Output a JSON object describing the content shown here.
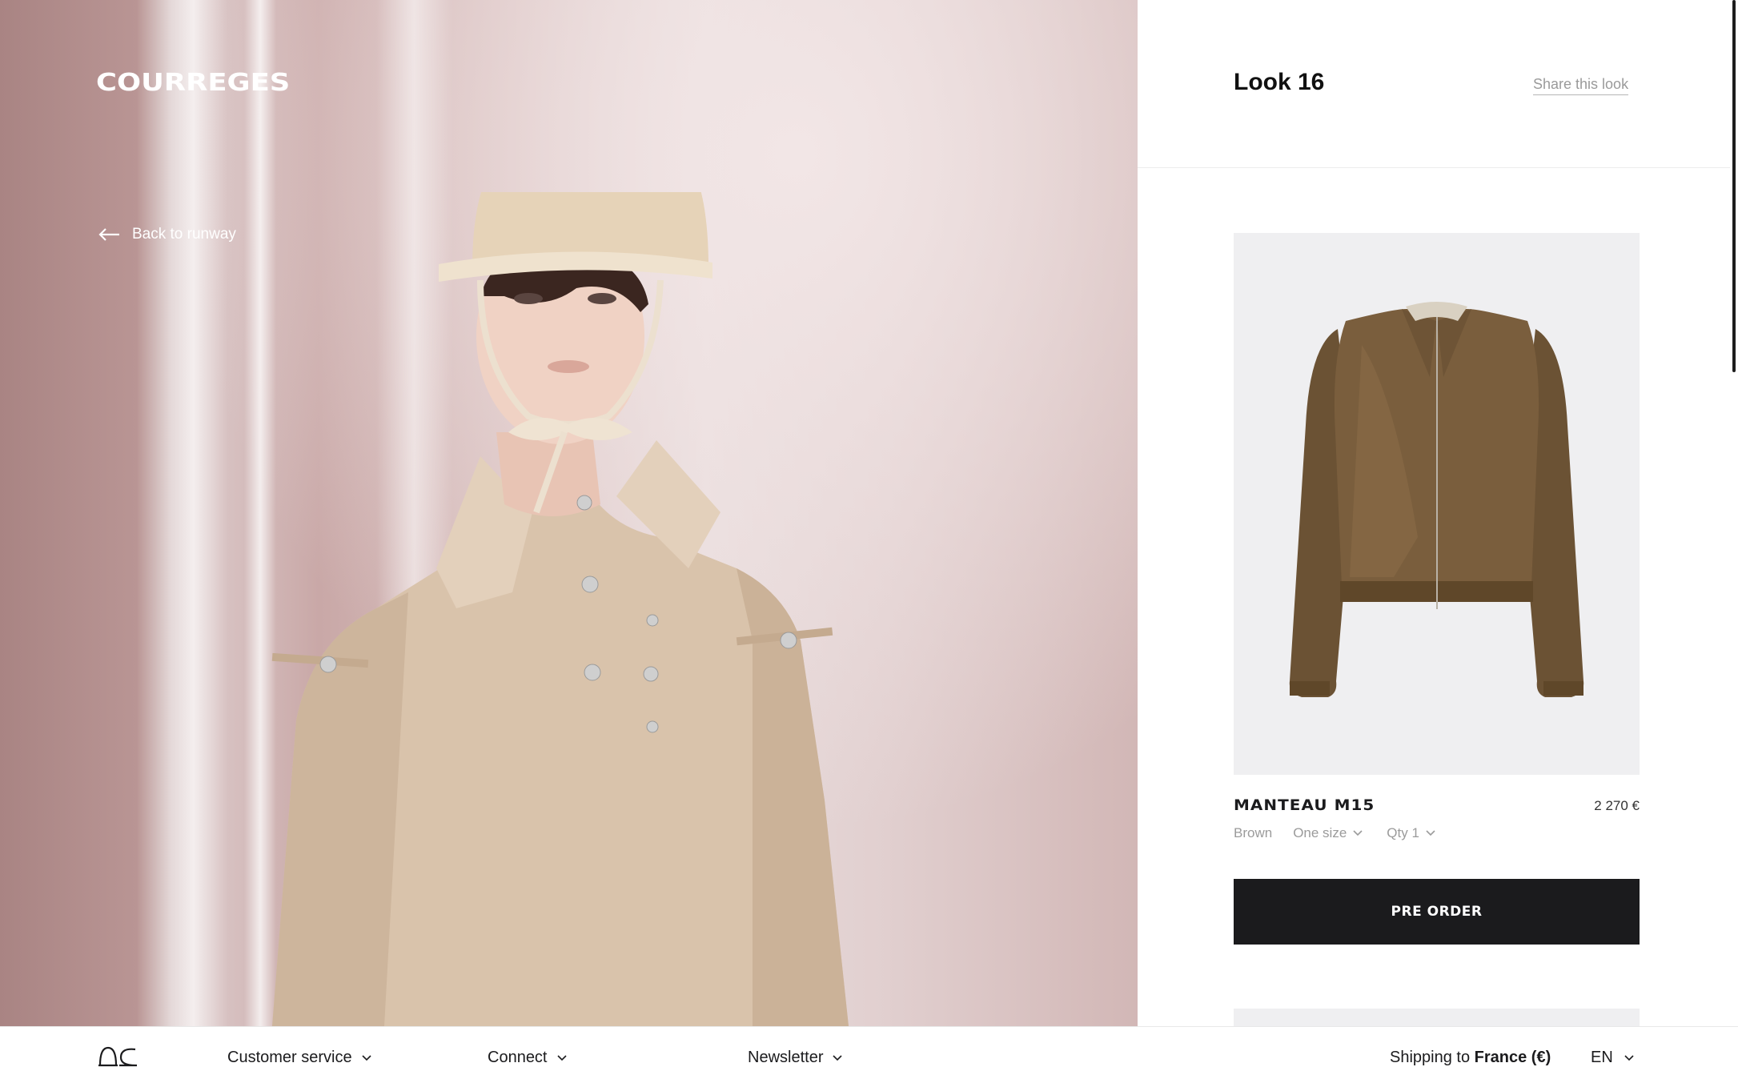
{
  "brand": {
    "name": "COURREGES"
  },
  "hero": {
    "back_label": "Back to runway"
  },
  "look": {
    "title": "Look 16",
    "share_label": "Share this look"
  },
  "product": {
    "name": "MANTEAU M15",
    "price": "2 270 €",
    "color": "Brown",
    "size": "One size",
    "qty": "Qty 1",
    "cta_label": "PRE ORDER"
  },
  "footer": {
    "customer_service": "Customer service",
    "connect": "Connect",
    "newsletter": "Newsletter",
    "shipping_prefix": "Shipping to",
    "shipping_country": "France (€)",
    "language": "EN"
  },
  "icons": [
    "arrow-left-icon",
    "chevron-down-icon",
    "courreges-monogram-icon"
  ],
  "colors": {
    "cta_background": "#1b1b1d",
    "product_bg": "#efeff1",
    "muted_text": "#9b9b9b"
  }
}
